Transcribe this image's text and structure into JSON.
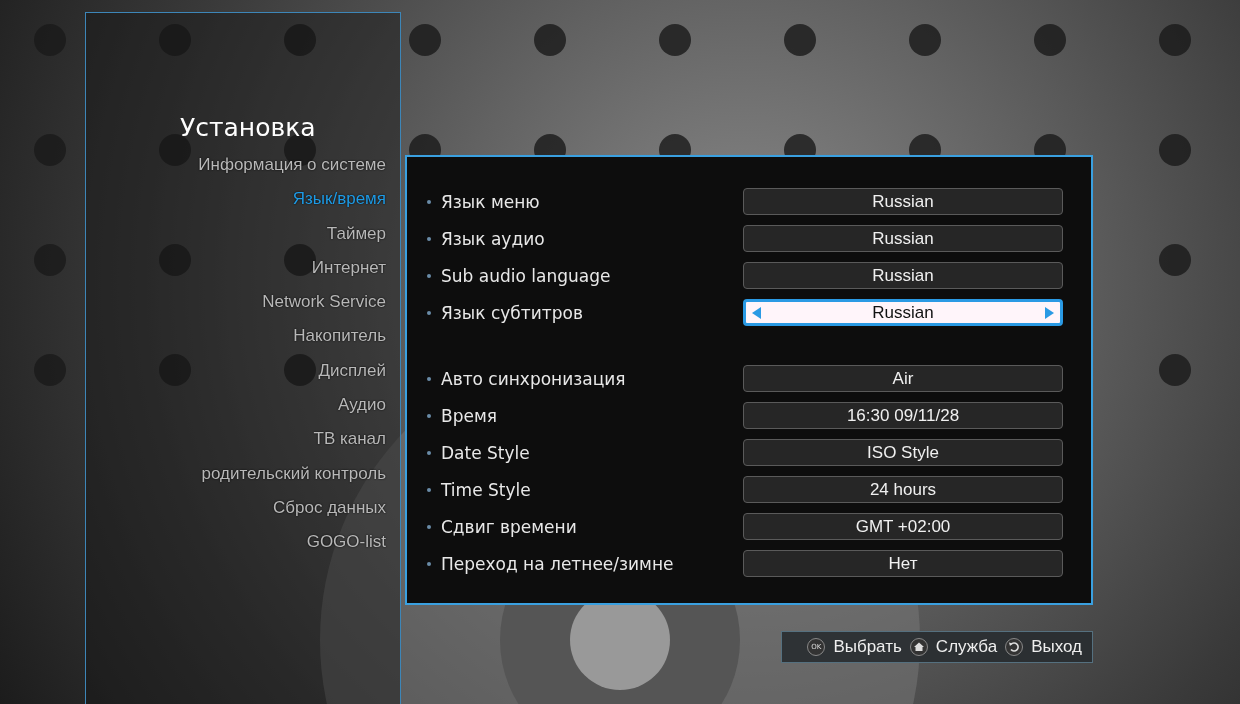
{
  "sidebar": {
    "title": "Установка",
    "items": [
      {
        "label": "Информация о системе",
        "selected": false
      },
      {
        "label": "Язык/время",
        "selected": true
      },
      {
        "label": "Таймер",
        "selected": false
      },
      {
        "label": "Интернет",
        "selected": false
      },
      {
        "label": "Network Service",
        "selected": false
      },
      {
        "label": "Накопитель",
        "selected": false
      },
      {
        "label": "Дисплей",
        "selected": false
      },
      {
        "label": "Аудио",
        "selected": false
      },
      {
        "label": "ТВ канал",
        "selected": false
      },
      {
        "label": "родительский контроль",
        "selected": false
      },
      {
        "label": "Сброс данных",
        "selected": false
      },
      {
        "label": "GOGO-list",
        "selected": false
      }
    ]
  },
  "settings_groups": [
    [
      {
        "label": "Язык меню",
        "value": "Russian",
        "selected": false
      },
      {
        "label": "Язык аудио",
        "value": "Russian",
        "selected": false
      },
      {
        "label": "Sub audio language",
        "value": "Russian",
        "selected": false
      },
      {
        "label": "Язык субтитров",
        "value": "Russian",
        "selected": true
      }
    ],
    [
      {
        "label": "Авто синхронизация",
        "value": "Air",
        "selected": false
      },
      {
        "label": "Время",
        "value": "16:30  09/11/28",
        "selected": false
      },
      {
        "label": "Date Style",
        "value": "ISO Style",
        "selected": false
      },
      {
        "label": "Time Style",
        "value": "24 hours",
        "selected": false
      },
      {
        "label": "Сдвиг времени",
        "value": "GMT +02:00",
        "selected": false
      },
      {
        "label": "Переход на летнее/зимне",
        "value": "Нет",
        "selected": false
      }
    ]
  ],
  "footer": [
    {
      "kind": "ok",
      "icon_label": "OK",
      "label": "Выбрать"
    },
    {
      "kind": "home",
      "label": "Служба"
    },
    {
      "kind": "back",
      "label": "Выход"
    }
  ]
}
